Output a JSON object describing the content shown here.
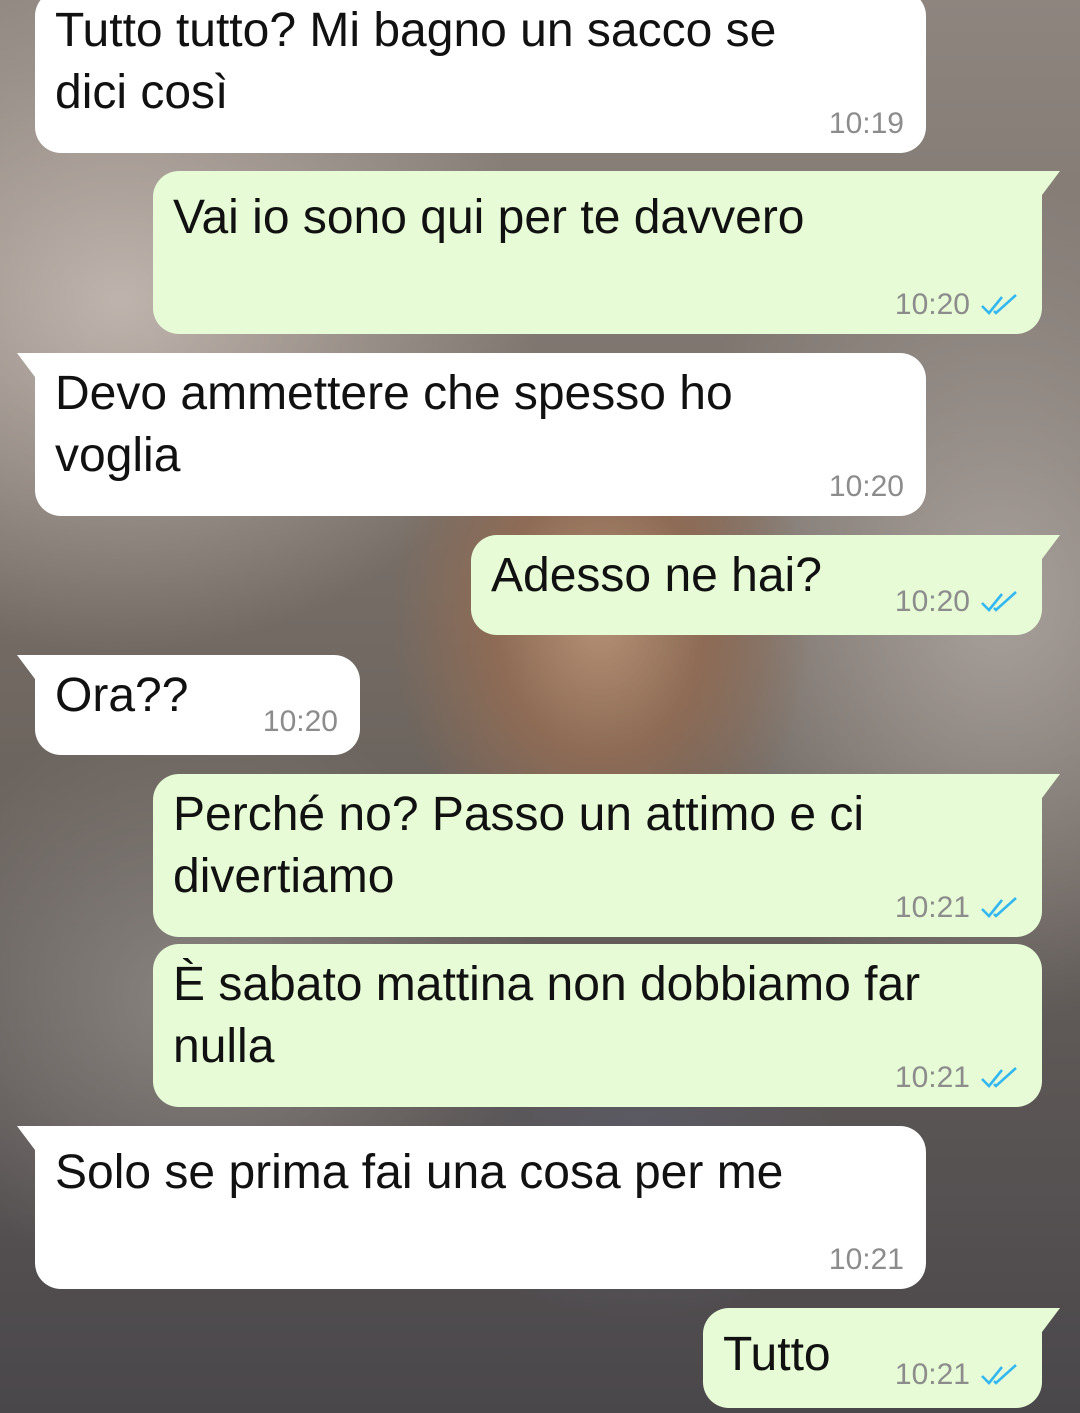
{
  "theme": {
    "incoming_bubble": "#ffffff",
    "outgoing_bubble": "#e7fcd6",
    "read_ticks_color": "#34b7f1"
  },
  "messages": [
    {
      "direction": "incoming",
      "text": "Tutto tutto? Mi bagno un sacco se\ndici così",
      "time": "10:19"
    },
    {
      "direction": "outgoing",
      "text": "Vai io sono qui per te davvero",
      "time": "10:20",
      "status_icon": "double-check-read-icon"
    },
    {
      "direction": "incoming",
      "text": "Devo ammettere che spesso ho\nvoglia",
      "time": "10:20"
    },
    {
      "direction": "outgoing",
      "text": "Adesso ne hai?",
      "time": "10:20",
      "status_icon": "double-check-read-icon"
    },
    {
      "direction": "incoming",
      "text": "Ora??",
      "time": "10:20"
    },
    {
      "direction": "outgoing",
      "text": "Perché no? Passo un attimo e ci\ndivertiamo",
      "time": "10:21",
      "status_icon": "double-check-read-icon"
    },
    {
      "direction": "outgoing",
      "text": "È sabato mattina non dobbiamo far\nnulla",
      "time": "10:21",
      "status_icon": "double-check-read-icon"
    },
    {
      "direction": "incoming",
      "text": "Solo se prima fai una cosa per me",
      "time": "10:21"
    },
    {
      "direction": "outgoing",
      "text": "Tutto",
      "time": "10:21",
      "status_icon": "double-check-read-icon"
    }
  ]
}
